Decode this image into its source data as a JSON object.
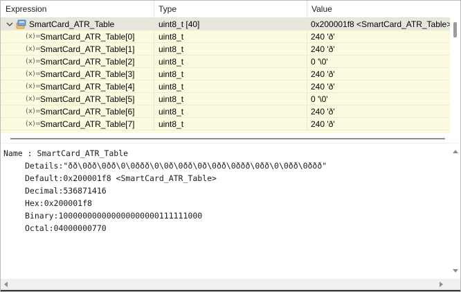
{
  "table": {
    "columns": {
      "expression": "Expression",
      "type": "Type",
      "value": "Value"
    },
    "parent": {
      "expression": "SmartCard_ATR_Table",
      "type": "uint8_t [40]",
      "value": "0x200001f8 <SmartCard_ATR_Table>",
      "expanded": true
    },
    "children": [
      {
        "expression": "SmartCard_ATR_Table[0]",
        "type": "uint8_t",
        "value": "240 'ð'"
      },
      {
        "expression": "SmartCard_ATR_Table[1]",
        "type": "uint8_t",
        "value": "240 'ð'"
      },
      {
        "expression": "SmartCard_ATR_Table[2]",
        "type": "uint8_t",
        "value": "0 '\\0'"
      },
      {
        "expression": "SmartCard_ATR_Table[3]",
        "type": "uint8_t",
        "value": "240 'ð'"
      },
      {
        "expression": "SmartCard_ATR_Table[4]",
        "type": "uint8_t",
        "value": "240 'ð'"
      },
      {
        "expression": "SmartCard_ATR_Table[5]",
        "type": "uint8_t",
        "value": "0 '\\0'"
      },
      {
        "expression": "SmartCard_ATR_Table[6]",
        "type": "uint8_t",
        "value": "240 'ð'"
      },
      {
        "expression": "SmartCard_ATR_Table[7]",
        "type": "uint8_t",
        "value": "240 'ð'"
      }
    ],
    "variable_icon_glyph": "(x)="
  },
  "details": {
    "name_line": "Name : SmartCard_ATR_Table",
    "lines": [
      "Details:\"ðð\\0ðð\\0ðð\\0\\0ððð\\0\\0ð\\0ðð\\0ð\\0ðð\\0ððð\\0ðð\\0\\0ðð\\0ððð\"",
      "Default:0x200001f8 <SmartCard_ATR_Table>",
      "Decimal:536871416",
      "Hex:0x200001f8",
      "Binary:100000000000000000000111111000",
      "Octal:04000000770"
    ]
  },
  "colors": {
    "row_background": "#fcfbdf",
    "selected_row_background": "#e6e6dc"
  }
}
